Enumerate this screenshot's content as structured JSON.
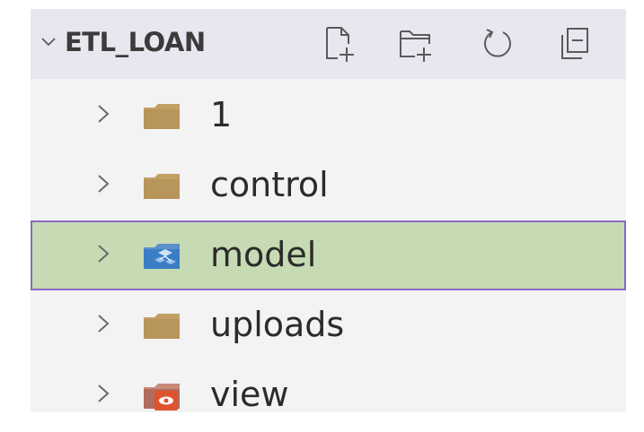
{
  "explorer": {
    "title": "ETL_LOAN",
    "actions": [
      {
        "name": "new-file-icon",
        "label": "New File"
      },
      {
        "name": "new-folder-icon",
        "label": "New Folder"
      },
      {
        "name": "refresh-icon",
        "label": "Refresh Explorer"
      },
      {
        "name": "collapse-all-icon",
        "label": "Collapse Folders in Explorer"
      }
    ],
    "items": [
      {
        "label": "1",
        "icon": "folder-icon"
      },
      {
        "label": "control",
        "icon": "folder-icon"
      },
      {
        "label": "model",
        "icon": "model-folder-icon",
        "selected": true
      },
      {
        "label": "uploads",
        "icon": "folder-icon"
      },
      {
        "label": "view",
        "icon": "view-folder-icon"
      }
    ]
  },
  "colors": {
    "header_bg": "#e9e6ef",
    "panel_bg": "#f3f3f3",
    "selected_bg": "#c6dbb3",
    "selected_border": "#8a67c8",
    "folder": "#c2a064",
    "model_icon": "#3b7dc4",
    "view_icon": "#e0532f"
  }
}
